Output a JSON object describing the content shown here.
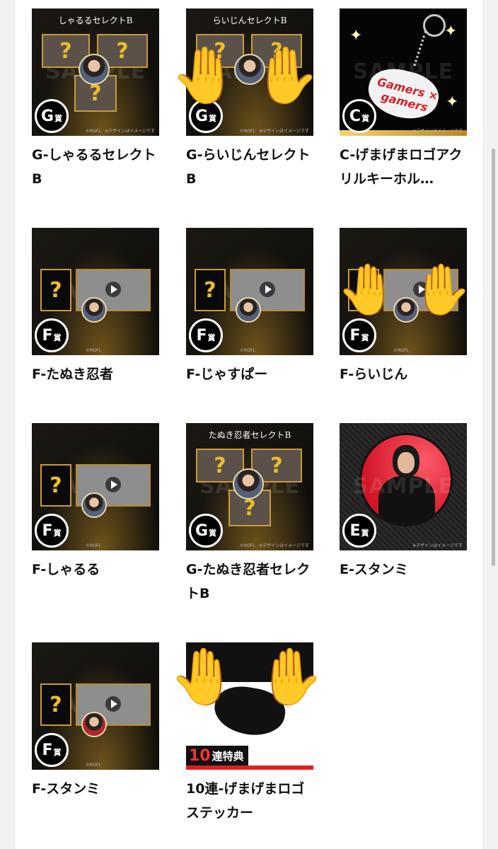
{
  "items": [
    {
      "caption": "G-しゃるるセレクトB",
      "badge": "G",
      "prize": "賞",
      "banner": "しゃるるセレクトB"
    },
    {
      "caption": "G-らいじんセレクトB",
      "badge": "G",
      "prize": "賞",
      "banner": "らいじんセレクトB"
    },
    {
      "caption": "C-げまげまロゴアクリルキーホル…",
      "badge": "C",
      "prize": "賞"
    },
    {
      "caption": "F-たぬき忍者",
      "badge": "F",
      "prize": "賞"
    },
    {
      "caption": "F-じゃすぱー",
      "badge": "F",
      "prize": "賞"
    },
    {
      "caption": "F-らいじん",
      "badge": "F",
      "prize": "賞"
    },
    {
      "caption": "F-しゃるる",
      "badge": "F",
      "prize": "賞"
    },
    {
      "caption": "G-たぬき忍者セレクトB",
      "badge": "G",
      "prize": "賞",
      "banner": "たぬき忍者セレクトB"
    },
    {
      "caption": "E-スタンミ",
      "badge": "E",
      "prize": "賞"
    },
    {
      "caption": "F-スタンミ",
      "badge": "F",
      "prize": "賞"
    },
    {
      "caption": "10連-げまげまロゴステッカー",
      "ten": "10",
      "ten_label": "連特典"
    }
  ],
  "thumb_text": {
    "sample": "SAMPLE",
    "copyright": "※デザインはイメージです",
    "rofl": "©ROFL",
    "question": "?"
  },
  "logo_text": "Gamers × gamers",
  "overlay": "🤚",
  "colors": {
    "gold": "#c89b3c",
    "badge_bg": "#000000",
    "sticker_red": "#e02020"
  }
}
